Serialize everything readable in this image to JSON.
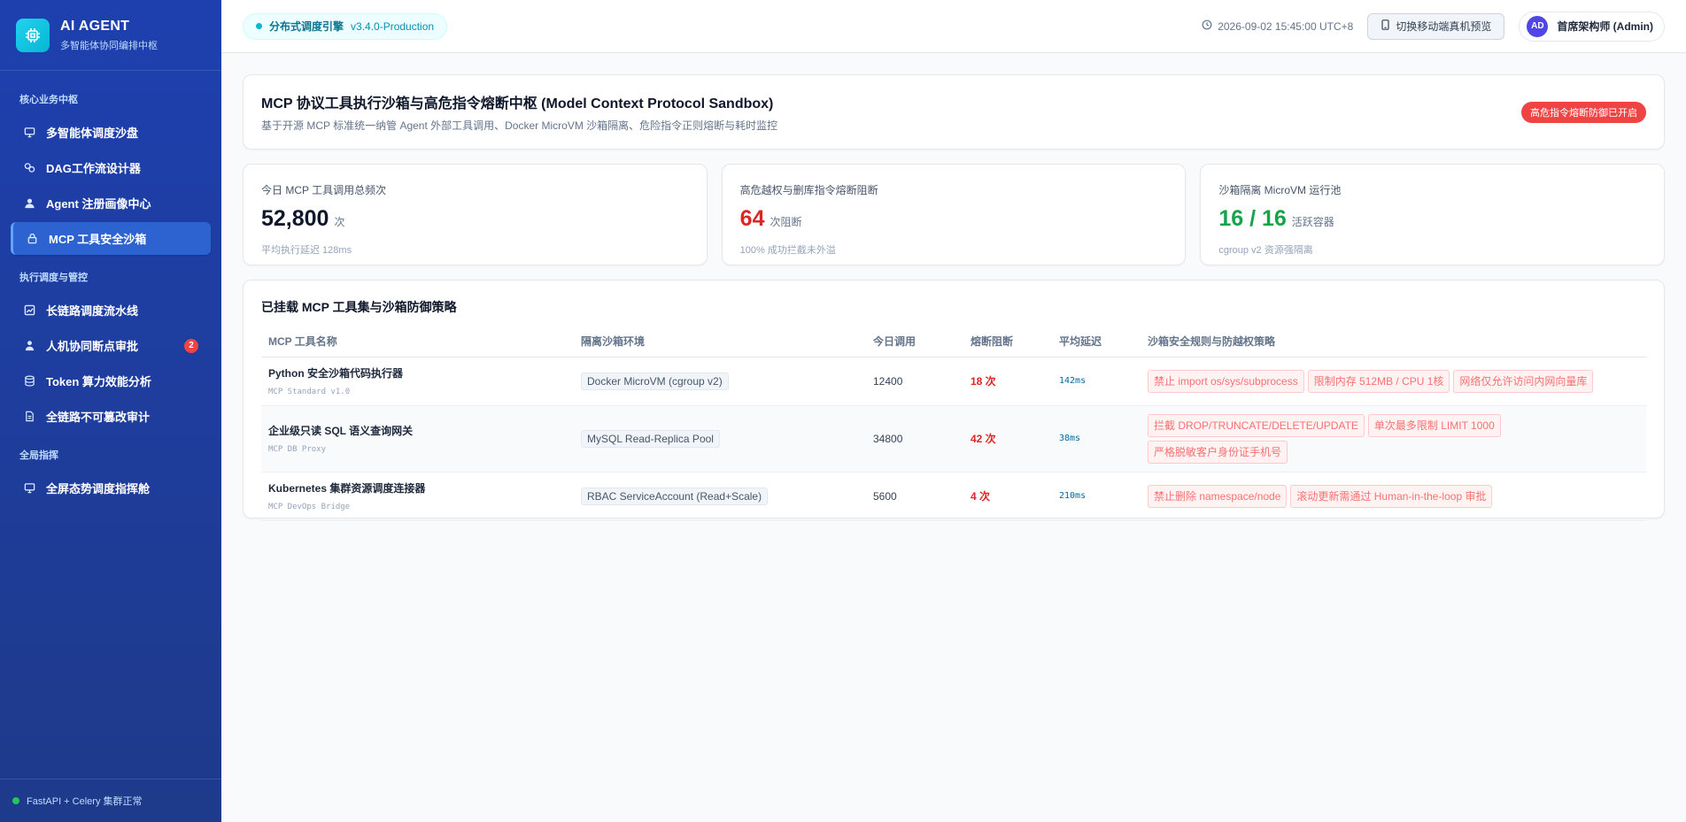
{
  "brand": {
    "title": "AI AGENT",
    "subtitle": "多智能体协同编排中枢",
    "logo_icon": "chip-icon"
  },
  "sidebar": {
    "groups": [
      {
        "label": "核心业务中枢",
        "items": [
          {
            "label": "多智能体调度沙盘",
            "icon": "monitor-icon"
          },
          {
            "label": "DAG工作流设计器",
            "icon": "workflow-icon"
          },
          {
            "label": "Agent 注册画像中心",
            "icon": "user-icon"
          },
          {
            "label": "MCP 工具安全沙箱",
            "icon": "lock-icon",
            "active": true
          }
        ]
      },
      {
        "label": "执行调度与管控",
        "items": [
          {
            "label": "长链路调度流水线",
            "icon": "chart-icon"
          },
          {
            "label": "人机协同断点审批",
            "icon": "person-icon",
            "badge": "2"
          },
          {
            "label": "Token 算力效能分析",
            "icon": "database-icon"
          },
          {
            "label": "全链路不可篡改审计",
            "icon": "file-icon"
          }
        ]
      },
      {
        "label": "全局指挥",
        "items": [
          {
            "label": "全屏态势调度指挥舱",
            "icon": "monitor-icon"
          }
        ]
      }
    ],
    "footer": "FastAPI + Celery 集群正常"
  },
  "header": {
    "engine_name": "分布式调度引擎",
    "engine_version": "v3.4.0-Production",
    "time": "2026-09-02 15:45:00 UTC+8",
    "mobile_button": "切换移动端真机预览",
    "user_initials": "AD",
    "user_name": "首席架构师 (Admin)"
  },
  "page": {
    "title": "MCP 协议工具执行沙箱与高危指令熔断中枢 (Model Context Protocol Sandbox)",
    "description": "基于开源 MCP 标准统一纳管 Agent 外部工具调用、Docker MicroVM 沙箱隔离、危险指令正则熔断与耗时监控",
    "alert": "高危指令熔断防御已开启"
  },
  "stats": [
    {
      "label": "今日 MCP 工具调用总频次",
      "value": "52,800",
      "unit": "次",
      "hint": "平均执行延迟 128ms",
      "color": "#0f172a"
    },
    {
      "label": "高危越权与删库指令熔断阻断",
      "value": "64",
      "unit": "次阻断",
      "hint": "100% 成功拦截未外溢",
      "color": "#dc2626"
    },
    {
      "label": "沙箱隔离 MicroVM 运行池",
      "value": "16 / 16",
      "unit": "活跃容器",
      "hint": "cgroup v2 资源强隔离",
      "color": "#16a34a"
    }
  ],
  "table": {
    "title": "已挂载 MCP 工具集与沙箱防御策略",
    "columns": [
      "MCP 工具名称",
      "隔离沙箱环境",
      "今日调用",
      "熔断阻断",
      "平均延迟",
      "沙箱安全规则与防越权策略"
    ],
    "rows": [
      {
        "name": "Python 安全沙箱代码执行器",
        "sub": "MCP Standard v1.0",
        "env": "Docker MicroVM (cgroup v2)",
        "calls": "12400",
        "blocked": "18 次",
        "latency": "142ms",
        "rules": [
          "禁止 import os/sys/subprocess",
          "限制内存 512MB / CPU 1核",
          "网络仅允许访问内网向量库"
        ]
      },
      {
        "name": "企业级只读 SQL 语义查询网关",
        "sub": "MCP DB Proxy",
        "env": "MySQL Read-Replica Pool",
        "calls": "34800",
        "blocked": "42 次",
        "latency": "38ms",
        "rules": [
          "拦截 DROP/TRUNCATE/DELETE/UPDATE",
          "单次最多限制 LIMIT 1000",
          "严格脱敏客户身份证手机号"
        ]
      },
      {
        "name": "Kubernetes 集群资源调度连接器",
        "sub": "MCP DevOps Bridge",
        "env": "RBAC ServiceAccount (Read+Scale)",
        "calls": "5600",
        "blocked": "4 次",
        "latency": "210ms",
        "rules": [
          "禁止删除 namespace/node",
          "滚动更新需通过 Human-in-the-loop 审批"
        ]
      }
    ]
  }
}
